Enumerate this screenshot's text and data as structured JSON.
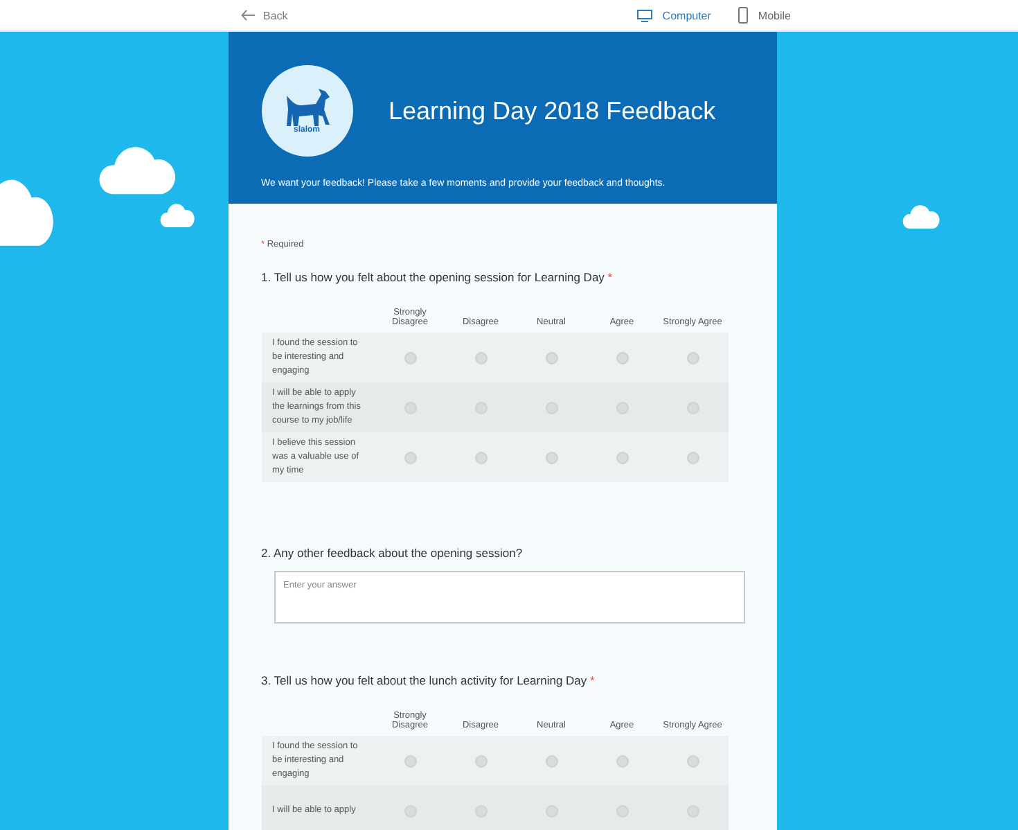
{
  "top_bar": {
    "back": "Back",
    "views": [
      {
        "label": "Computer",
        "kind": "computer",
        "selected": true
      },
      {
        "label": "Mobile",
        "kind": "mobile",
        "selected": false
      }
    ]
  },
  "header": {
    "title": "Learning Day 2018 Feedback",
    "logo_text": "slalom",
    "description": "We want your feedback! Please take a few moments and provide your feedback and thoughts."
  },
  "required_note": {
    "mark": "*",
    "label": "Required"
  },
  "questions": [
    {
      "kind": "likert",
      "title": "1. Tell us how you felt about the opening session for Learning Day",
      "required": true,
      "columns": [
        "Strongly Disagree",
        "Disagree",
        "Neutral",
        "Agree",
        "Strongly Agree"
      ],
      "rows": [
        {
          "label": "I found the session to be interesting and engaging",
          "choices": [
            {
              "checked": false
            },
            {
              "checked": false
            },
            {
              "checked": false
            },
            {
              "checked": false
            },
            {
              "checked": false
            }
          ]
        },
        {
          "label": "I will be able to apply the learnings from this course to my job/life",
          "choices": [
            {
              "checked": false
            },
            {
              "checked": false
            },
            {
              "checked": false
            },
            {
              "checked": false
            },
            {
              "checked": false
            }
          ]
        },
        {
          "label": "I believe this session was a valuable use of my time",
          "choices": [
            {
              "checked": false
            },
            {
              "checked": false
            },
            {
              "checked": false
            },
            {
              "checked": false
            },
            {
              "checked": false
            }
          ]
        }
      ]
    },
    {
      "kind": "text",
      "title": "2. Any other feedback about the opening session?",
      "required": false,
      "placeholder": "Enter your answer"
    },
    {
      "kind": "likert",
      "title": "3. Tell us how you felt about the lunch activity for Learning Day",
      "required": true,
      "columns": [
        "Strongly Disagree",
        "Disagree",
        "Neutral",
        "Agree",
        "Strongly Agree"
      ],
      "rows": [
        {
          "label": "I found the session to be interesting and engaging",
          "choices": [
            {
              "checked": false
            },
            {
              "checked": false
            },
            {
              "checked": false
            },
            {
              "checked": false
            },
            {
              "checked": false
            }
          ]
        },
        {
          "label": "I will be able to apply",
          "choices": [
            {
              "checked": false
            },
            {
              "checked": false
            },
            {
              "checked": false
            },
            {
              "checked": false
            },
            {
              "checked": false
            }
          ]
        }
      ]
    }
  ]
}
